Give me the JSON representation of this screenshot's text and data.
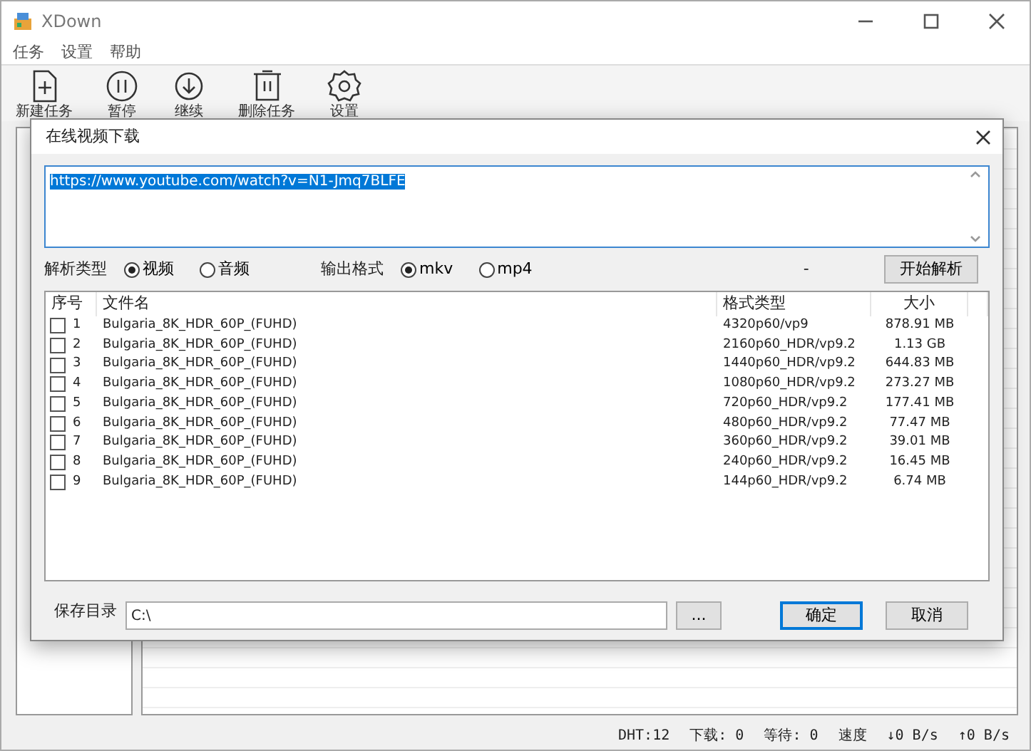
{
  "window": {
    "title": "XDown"
  },
  "menu": [
    "任务",
    "设置",
    "帮助"
  ],
  "toolbar": [
    "新建任务",
    "暂停",
    "继续",
    "删除任务",
    "设置"
  ],
  "dialog": {
    "title": "在线视频下载",
    "url": {
      "value": "https://www.youtube.com/watch?v=N1-Jmq7BLFE",
      "selected": true
    },
    "parse_type": {
      "label": "解析类型",
      "options": [
        {
          "label": "视频",
          "selected": true
        },
        {
          "label": "音频",
          "selected": false
        }
      ]
    },
    "output_format": {
      "label": "输出格式",
      "options": [
        {
          "label": "mkv",
          "selected": true
        },
        {
          "label": "mp4",
          "selected": false
        }
      ]
    },
    "status": "-",
    "parse_button": "开始解析",
    "table": {
      "columns": [
        "序号",
        "文件名",
        "格式类型",
        "大小"
      ],
      "rows": [
        {
          "checked": false,
          "index": "1",
          "name": "Bulgaria_8K_HDR_60P_(FUHD)",
          "format": "4320p60/vp9",
          "size": "878.91 MB"
        },
        {
          "checked": false,
          "index": "2",
          "name": "Bulgaria_8K_HDR_60P_(FUHD)",
          "format": "2160p60_HDR/vp9.2",
          "size": "1.13 GB"
        },
        {
          "checked": false,
          "index": "3",
          "name": "Bulgaria_8K_HDR_60P_(FUHD)",
          "format": "1440p60_HDR/vp9.2",
          "size": "644.83 MB"
        },
        {
          "checked": false,
          "index": "4",
          "name": "Bulgaria_8K_HDR_60P_(FUHD)",
          "format": "1080p60_HDR/vp9.2",
          "size": "273.27 MB"
        },
        {
          "checked": false,
          "index": "5",
          "name": "Bulgaria_8K_HDR_60P_(FUHD)",
          "format": "720p60_HDR/vp9.2",
          "size": "177.41 MB"
        },
        {
          "checked": false,
          "index": "6",
          "name": "Bulgaria_8K_HDR_60P_(FUHD)",
          "format": "480p60_HDR/vp9.2",
          "size": "77.47 MB"
        },
        {
          "checked": false,
          "index": "7",
          "name": "Bulgaria_8K_HDR_60P_(FUHD)",
          "format": "360p60_HDR/vp9.2",
          "size": "39.01 MB"
        },
        {
          "checked": false,
          "index": "8",
          "name": "Bulgaria_8K_HDR_60P_(FUHD)",
          "format": "240p60_HDR/vp9.2",
          "size": "16.45 MB"
        },
        {
          "checked": false,
          "index": "9",
          "name": "Bulgaria_8K_HDR_60P_(FUHD)",
          "format": "144p60_HDR/vp9.2",
          "size": "6.74 MB"
        }
      ]
    },
    "save_dir": {
      "label": "保存目录",
      "value": "C:\\",
      "browse": "..."
    },
    "buttons": [
      {
        "label": "确定",
        "default": true
      },
      {
        "label": "取消",
        "default": false
      }
    ]
  },
  "status_bar": [
    "DHT:12",
    "下载: 0",
    "等待: 0",
    "速度",
    "↓0 B/s",
    "↑0 B/s"
  ]
}
